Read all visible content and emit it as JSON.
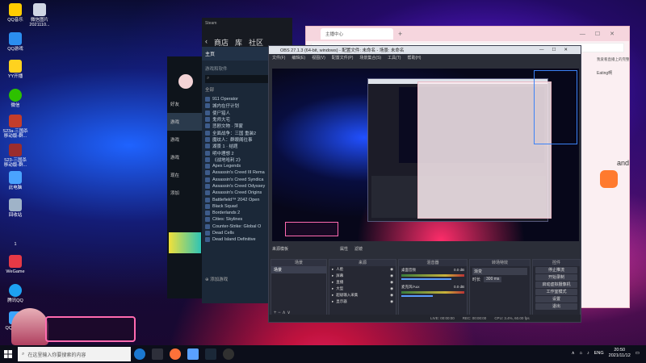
{
  "desktop": {
    "icons": [
      {
        "label": "QQ音乐",
        "color": "#ffcc00"
      },
      {
        "label": "微信图片\n2021110...",
        "color": "#cfd6e4"
      },
      {
        "label": "QQ游戏",
        "color": "#2b8ef0"
      },
      {
        "label": "YY开播",
        "color": "#ffd21f"
      },
      {
        "label": "微信",
        "color": "#2dc100"
      },
      {
        "label": "S23a-三国杀\n移动版-群...",
        "color": "#c43d2b"
      },
      {
        "label": "S23-三国杀\n移动版-群...",
        "color": "#9b2d2d"
      },
      {
        "label": "此电脑",
        "color": "#4aa3ff"
      },
      {
        "label": "回收站",
        "color": "#9fb3c8"
      },
      {
        "label": "1",
        "color": "#e0e0e0"
      },
      {
        "label": "WeGame",
        "color": "#e63946"
      },
      {
        "label": "腾讯QQ",
        "color": "#1da1f2"
      },
      {
        "label": "QQ浏览器",
        "color": "#3ba5ff"
      }
    ]
  },
  "steam": {
    "menu": "Steam",
    "nav": [
      "商店",
      "库",
      "社区"
    ],
    "home": "主页",
    "filter_label": "游戏和软件",
    "all_label": "全部",
    "sidebar": [
      "好友",
      "游戏",
      "游戏",
      "游戏",
      "现在",
      "添加"
    ],
    "games": [
      "911 Operator",
      "城内在仔计划",
      "使尸猎人",
      "鬼师大宅",
      "悲剧文物 · 萍蒙",
      "全面战争：三国 重装2",
      "魔纹人：群眼阁往事",
      "湖景 1 · 结题",
      "明中理想 2",
      "《战地哈利 2》",
      "Apex Legends",
      "Assassin's Creed III Rema",
      "Assassin's Creed Syndica",
      "Assassin's Creed Odyssey",
      "Assassin's Creed Origins",
      "Battlefield™ 2042 Open",
      "Black Squad",
      "Borderlands 2",
      "Cities: Skylines",
      "Counter-Strike: Global O",
      "Dead Cells",
      "Dead Island Definitive"
    ],
    "add_label": "添加游戏"
  },
  "browser": {
    "tab_label": "主播中心",
    "side_text": "Eating啊",
    "banner_text": "我爱看直播上的完整",
    "right_text": "andX"
  },
  "obs": {
    "title": "OBS 27.1.3 (64-bit, windows) - 配置文件: 未命名 - 场景: 未命名",
    "menu": [
      "文件(F)",
      "编辑(E)",
      "视图(V)",
      "配置文件(P)",
      "场景集合(S)",
      "工具(T)",
      "帮助(H)"
    ],
    "overlay_title": "来源模板",
    "overlay_btns": [
      "属性",
      "滤镜"
    ],
    "docks": {
      "scenes": {
        "title": "场景",
        "item": "场景"
      },
      "sources": {
        "title": "来源",
        "items": [
          "人脸",
          "屏幕",
          "直播",
          "大型",
          "超级输入采集",
          "显示器"
        ]
      },
      "mixer": {
        "title": "混音器",
        "tracks": [
          {
            "name": "桌面音频",
            "db": "0.0 dB"
          },
          {
            "name": "麦克风/Aux",
            "db": "0.0 dB"
          }
        ]
      },
      "transitions": {
        "title": "转场特效",
        "type": "渐变",
        "duration_label": "时长",
        "duration": "300 ms"
      },
      "controls": {
        "title": "控件",
        "buttons": [
          "停止推流",
          "开始录制",
          "启动虚拟摄像机",
          "工作室模式",
          "设置",
          "退出"
        ]
      }
    },
    "status": [
      "LIVE: 00:00:00",
      "REC: 00:00:00",
      "CPU: 3.4%, 60.00 fps"
    ]
  },
  "taskbar": {
    "search_placeholder": "在这里输入你要搜索的内容",
    "lang": "ENG",
    "time": "20:50",
    "date": "2021/11/12"
  },
  "colors": {
    "obs_bg": "#2b2e38",
    "steam_bg": "#1b2838",
    "browser_bg": "#fbeff2",
    "accent_pink": "#ff2d7a"
  }
}
